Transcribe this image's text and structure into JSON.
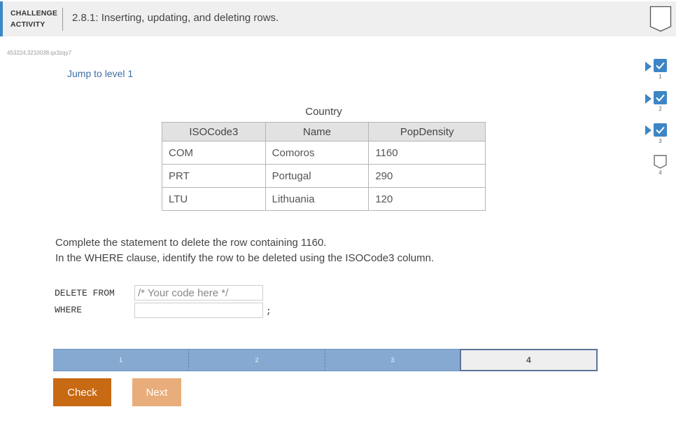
{
  "header": {
    "activity_type_line1": "CHALLENGE",
    "activity_type_line2": "ACTIVITY",
    "title": "2.8.1: Inserting, updating, and deleting rows."
  },
  "activity_id": "453224.3210038.qx3zqy7",
  "jump_link": "Jump to level 1",
  "levels_checklist": [
    {
      "number": "1",
      "completed": true
    },
    {
      "number": "2",
      "completed": true
    },
    {
      "number": "3",
      "completed": true
    },
    {
      "number": "4",
      "completed": false
    }
  ],
  "table": {
    "caption": "Country",
    "columns": [
      "ISOCode3",
      "Name",
      "PopDensity"
    ],
    "rows": [
      [
        "COM",
        "Comoros",
        "1160"
      ],
      [
        "PRT",
        "Portugal",
        "290"
      ],
      [
        "LTU",
        "Lithuania",
        "120"
      ]
    ]
  },
  "instructions": {
    "line1": "Complete the statement to delete the row containing 1160.",
    "line2": "In the WHERE clause, identify the row to be deleted using the ISOCode3 column."
  },
  "code": {
    "delete_from_keyword": "DELETE FROM",
    "table_placeholder": "/* Your code here */",
    "table_value": "",
    "where_keyword": "WHERE",
    "where_value": "",
    "terminator": ";"
  },
  "level_bar": [
    {
      "label": "1",
      "state": "completed"
    },
    {
      "label": "2",
      "state": "completed"
    },
    {
      "label": "3",
      "state": "completed"
    },
    {
      "label": "4",
      "state": "current"
    }
  ],
  "buttons": {
    "check": "Check",
    "next": "Next"
  },
  "colors": {
    "accent_blue": "#3c86c5",
    "check_button": "#c86913",
    "next_button_disabled": "#e8ad7a",
    "level_completed": "#86a9d1",
    "link": "#3d6ea6"
  }
}
